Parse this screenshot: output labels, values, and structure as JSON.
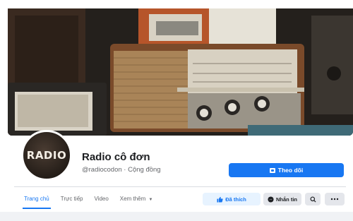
{
  "page": {
    "name": "Radio cô đơn",
    "subtitle": "@radiocodon · Cộng đồng",
    "avatar_text": "RADIO"
  },
  "actions": {
    "follow_label": "Theo dõi",
    "like_label": "Đã thích",
    "message_label": "Nhắn tin"
  },
  "tabs": [
    {
      "label": "Trang chủ",
      "active": true
    },
    {
      "label": "Trực tiếp",
      "active": false
    },
    {
      "label": "Video",
      "active": false
    },
    {
      "label": "Xem thêm",
      "active": false,
      "has_caret": true
    }
  ],
  "icons": {
    "follow": "calendar-icon",
    "like": "thumbs-up-icon",
    "message": "messenger-icon",
    "search": "search-icon",
    "more": "more-icon",
    "caret": "caret-down-icon"
  },
  "colors": {
    "accent": "#1877f2",
    "accent_light": "#e7f3ff",
    "button_gray": "#e4e6eb",
    "text_primary": "#1c1e21",
    "text_secondary": "#65676b"
  }
}
